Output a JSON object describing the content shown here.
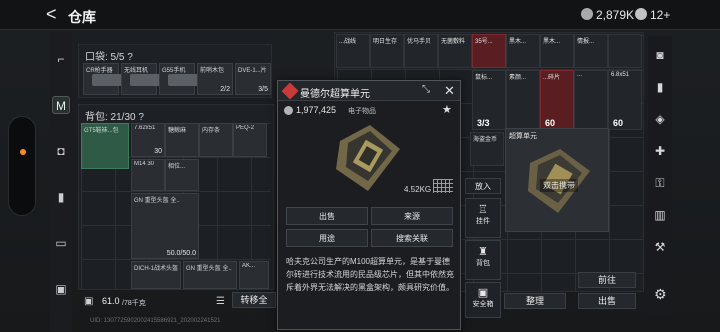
{
  "header": {
    "back_label": "<",
    "title": "仓库",
    "money": "2,879K",
    "tickets": "12+"
  },
  "pocket": {
    "title": "口袋: 5/5 ?",
    "items": [
      {
        "label": "CR枪手器",
        "count": ""
      },
      {
        "label": "无线耳机",
        "count": ""
      },
      {
        "label": "G55手机",
        "count": ""
      },
      {
        "label": "前哨木包",
        "count": "2/2"
      },
      {
        "label": "DVE-1...片",
        "count": "3/5"
      }
    ]
  },
  "backpack": {
    "title": "背包: 21/30 ?",
    "items": [
      {
        "label": "GT5鞋袜...包",
        "count": ""
      },
      {
        "label": "7.62x51",
        "count": "30"
      },
      {
        "label": "糖鲸麻",
        "count": ""
      },
      {
        "label": "内存条",
        "count": ""
      },
      {
        "label": "PEQ-2",
        "count": ""
      },
      {
        "label": "M14 30",
        "count": ""
      },
      {
        "label": "相位...",
        "count": ""
      },
      {
        "label": "GN 重型头盔 全...",
        "count": "50.0/50.0"
      },
      {
        "label": "DICH-1战术头盔",
        "count": ""
      },
      {
        "label": "GN 重型头盔 全...",
        "count": ""
      },
      {
        "label": "AK...",
        "count": ""
      }
    ]
  },
  "weight": {
    "value": "61.0",
    "max": "/78千克"
  },
  "transfer_label": "转移全",
  "storage": {
    "items": [
      {
        "label": "...战线",
        "count": ""
      },
      {
        "label": "明日生存",
        "count": ""
      },
      {
        "label": "优马手贝",
        "count": ""
      },
      {
        "label": "无菌敷料",
        "count": ""
      },
      {
        "label": "35号...",
        "count": ""
      },
      {
        "label": "黑木...",
        "count": ""
      },
      {
        "label": "黑木...",
        "count": ""
      },
      {
        "label": "情报...",
        "count": ""
      },
      {
        "label": "...碎片",
        "count": "60"
      },
      {
        "label": "6.8x51",
        "count": "60"
      },
      {
        "label": "...",
        "count": ""
      },
      {
        "label": "鼠标...",
        "count": "3/3"
      },
      {
        "label": "素颜...",
        "count": ""
      },
      {
        "label": "...",
        "count": ""
      },
      {
        "label": "海盗金币",
        "count": ""
      }
    ]
  },
  "popup": {
    "title": "曼德尔超算单元",
    "price": "1,977,425",
    "category": "电子物品",
    "weight": "4.52KG",
    "buttons": {
      "sell": "出售",
      "source": "来源",
      "use": "用途",
      "search": "搜索关联"
    },
    "description": "哈夫克公司生产的M100超算单元，是基于曼德尔砖进行技术流用的民品级芯片，但其中依然充斥着外界无法解决的黑盒架构，颇具研究价值。"
  },
  "detail": {
    "label": "超算单元",
    "hint": "双击携带"
  },
  "actions": {
    "place": "放入",
    "hang": "挂件",
    "bag": "背包",
    "safe": "安全箱"
  },
  "bottom": {
    "forward": "前往",
    "organize": "整理",
    "sell": "出售"
  },
  "footer": "UID: 1307725902002415586921_202002241521",
  "colors": {
    "accent": "#ff8a1f",
    "danger": "#c93b3b",
    "green_slot": "#2f5a45"
  }
}
